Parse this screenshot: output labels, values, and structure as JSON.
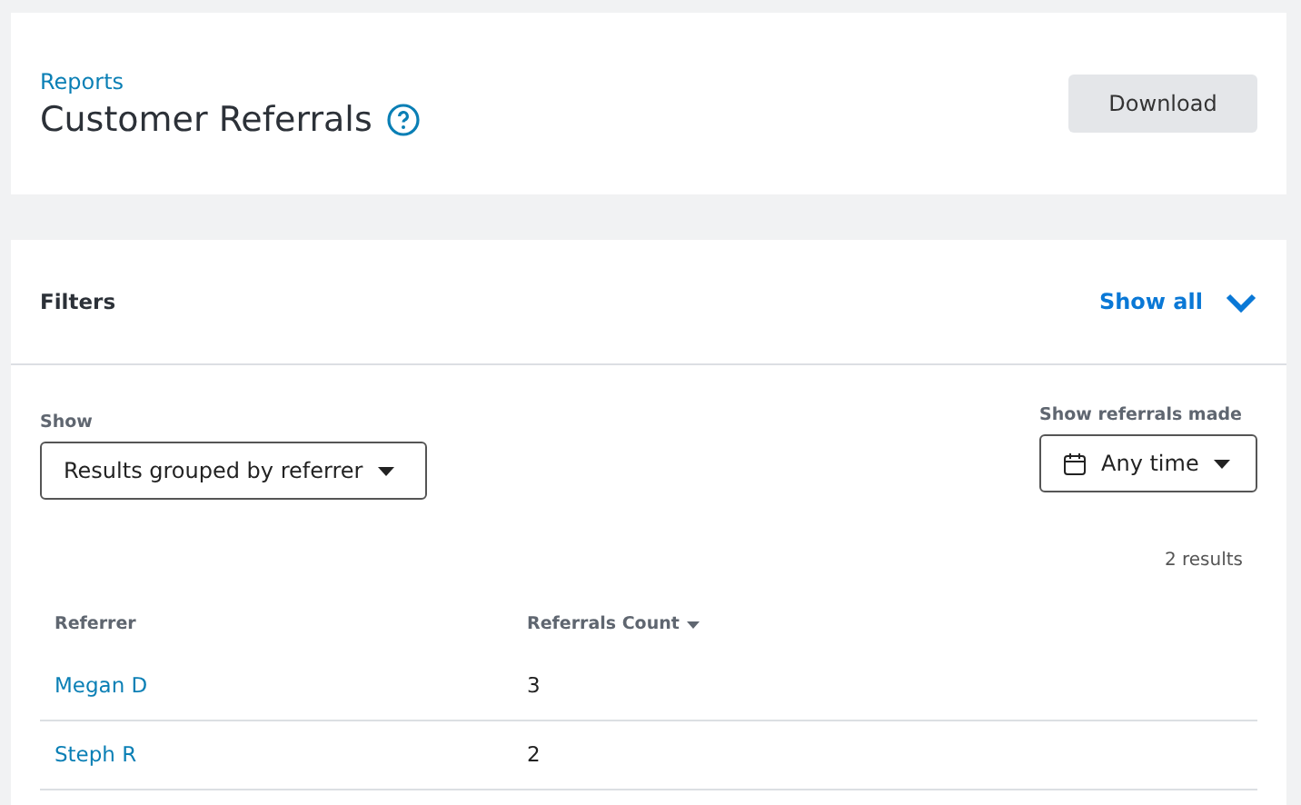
{
  "header": {
    "breadcrumb": "Reports",
    "title": "Customer Referrals",
    "download_button": "Download"
  },
  "filters": {
    "title": "Filters",
    "toggle": "Show all",
    "expanded": false,
    "show": {
      "label": "Show",
      "value": "Results grouped by referrer"
    },
    "period": {
      "label": "Show referrals made",
      "value": "Any time"
    }
  },
  "results_count": "2 results",
  "table": {
    "columns": [
      {
        "label": "Referrer",
        "sorted": false
      },
      {
        "label": "Referrals Count",
        "sorted": true
      }
    ],
    "rows": [
      {
        "referrer": "Megan D",
        "count": "3"
      },
      {
        "referrer": "Steph R",
        "count": "2"
      }
    ]
  }
}
